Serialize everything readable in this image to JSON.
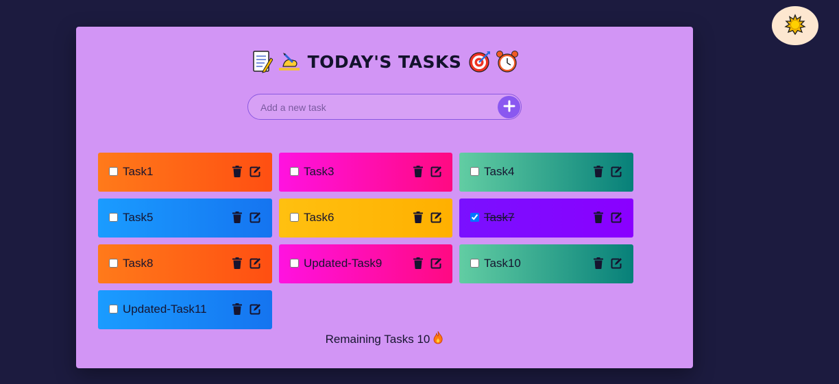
{
  "header": {
    "title": "TODAY'S TASKS",
    "title_emojis_left": [
      "memo-icon",
      "writing-hand-icon"
    ],
    "title_emojis_right": [
      "target-icon",
      "alarm-clock-icon"
    ]
  },
  "theme_toggle": {
    "icon": "sun-icon"
  },
  "new_task": {
    "placeholder": "Add a new task",
    "value": "",
    "add_icon": "plus-icon"
  },
  "tasks": [
    {
      "label": "Task1",
      "checked": false,
      "color": "orange"
    },
    {
      "label": "Task3",
      "checked": false,
      "color": "pink"
    },
    {
      "label": "Task4",
      "checked": false,
      "color": "teal"
    },
    {
      "label": "Task5",
      "checked": false,
      "color": "blue"
    },
    {
      "label": "Task6",
      "checked": false,
      "color": "yellow"
    },
    {
      "label": "Task7",
      "checked": true,
      "color": "purple"
    },
    {
      "label": "Task8",
      "checked": false,
      "color": "orange"
    },
    {
      "label": "Updated-Task9",
      "checked": false,
      "color": "pink"
    },
    {
      "label": "Task10",
      "checked": false,
      "color": "teal"
    },
    {
      "label": "Updated-Task11",
      "checked": false,
      "color": "blue"
    }
  ],
  "footer": {
    "remaining_label": "Remaining Tasks 10",
    "icon": "fire-icon"
  },
  "colors": {
    "background": "#1c1b3f",
    "card": "#d295f5",
    "accent": "#8a58f0",
    "toggle": "#fde7d0"
  }
}
